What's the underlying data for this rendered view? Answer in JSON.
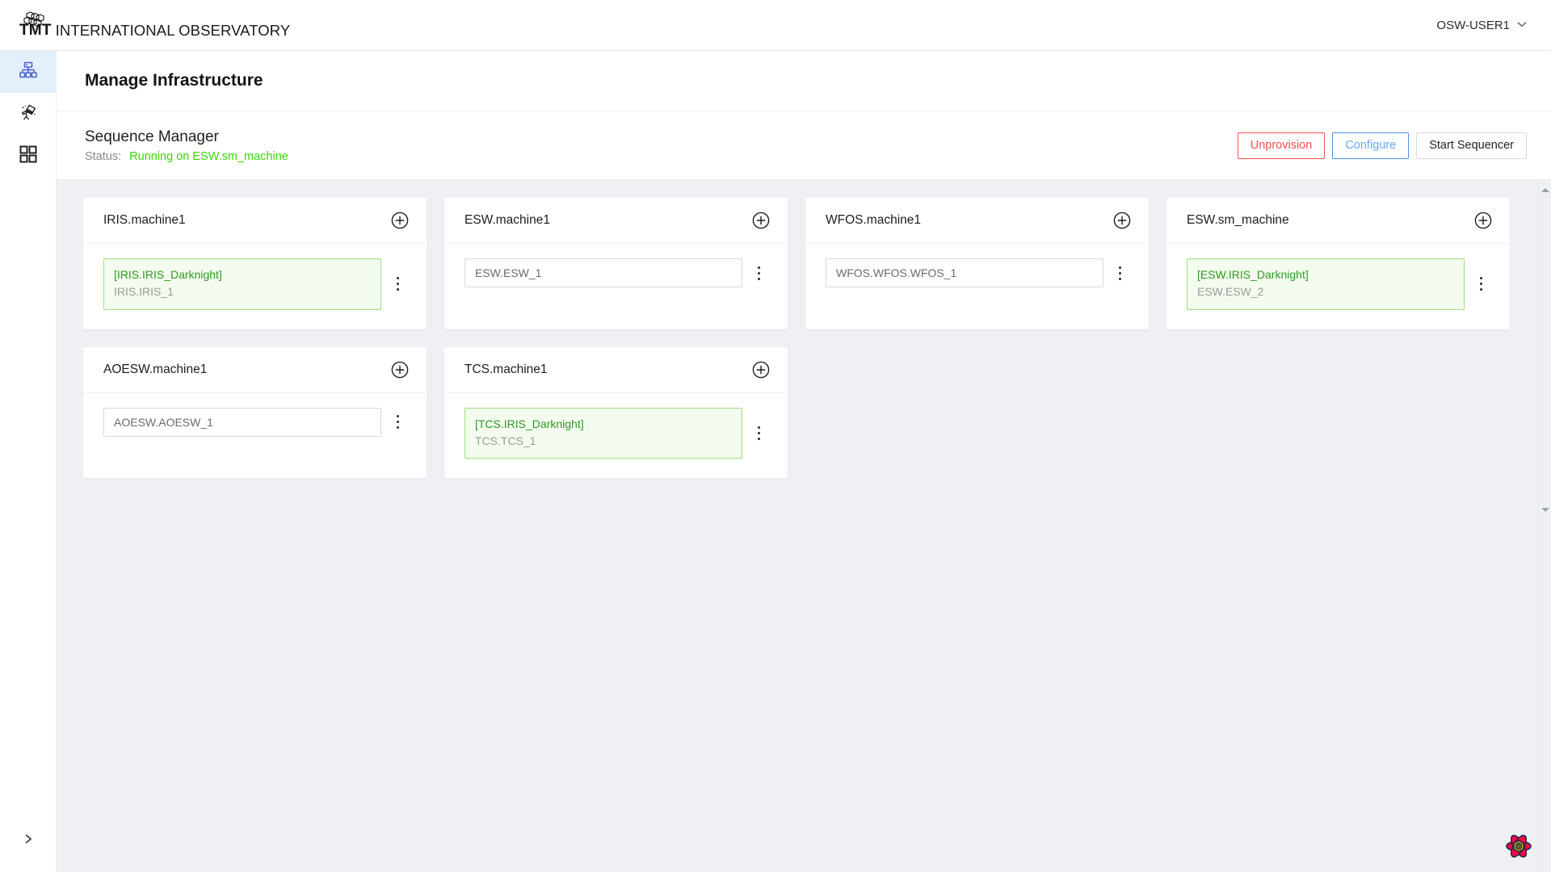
{
  "header": {
    "logo_tmt": "TMT",
    "logo_rest": "INTERNATIONAL OBSERVATORY",
    "logo_icon": "tmt-mirror-segments-logo",
    "user": "OSW-USER1",
    "user_caret_icon": "chevron-down-icon"
  },
  "rail": {
    "items": [
      {
        "icon": "infrastructure-hierarchy-icon",
        "active": true
      },
      {
        "icon": "telescope-icon",
        "active": false
      },
      {
        "icon": "apps-grid-icon",
        "active": false
      }
    ],
    "expand_icon": "chevron-right-icon"
  },
  "page": {
    "title": "Manage Infrastructure"
  },
  "sequence_manager": {
    "name": "Sequence Manager",
    "status_label": "Status:",
    "status_value": "Running on ESW.sm_machine",
    "status_color": "#36d900",
    "actions": [
      {
        "label": "Unprovision",
        "style": "danger"
      },
      {
        "label": "Configure",
        "style": "primary-ghost"
      },
      {
        "label": "Start Sequencer",
        "style": "default"
      }
    ]
  },
  "agents": [
    {
      "title": "IRIS.machine1",
      "add_icon": "plus-circle-icon",
      "sequencers": [
        {
          "running": true,
          "obs_mode": "[IRIS.IRIS_Darknight]",
          "id": "IRIS.IRIS_1",
          "menu_icon": "more-vertical-icon"
        }
      ]
    },
    {
      "title": "ESW.machine1",
      "add_icon": "plus-circle-icon",
      "sequencers": [
        {
          "running": false,
          "obs_mode": "",
          "id": "ESW.ESW_1",
          "menu_icon": "more-vertical-icon"
        }
      ]
    },
    {
      "title": "WFOS.machine1",
      "add_icon": "plus-circle-icon",
      "sequencers": [
        {
          "running": false,
          "obs_mode": "",
          "id": "WFOS.WFOS.WFOS_1",
          "menu_icon": "more-vertical-icon"
        }
      ]
    },
    {
      "title": "ESW.sm_machine",
      "add_icon": "plus-circle-icon",
      "sequencers": [
        {
          "running": true,
          "obs_mode": "[ESW.IRIS_Darknight]",
          "id": "ESW.ESW_2",
          "menu_icon": "more-vertical-icon"
        }
      ]
    },
    {
      "title": "AOESW.machine1",
      "add_icon": "plus-circle-icon",
      "sequencers": [
        {
          "running": false,
          "obs_mode": "",
          "id": "AOESW.AOESW_1",
          "menu_icon": "more-vertical-icon"
        }
      ]
    },
    {
      "title": "TCS.machine1",
      "add_icon": "plus-circle-icon",
      "sequencers": [
        {
          "running": true,
          "obs_mode": "[TCS.IRIS_Darknight]",
          "id": "TCS.TCS_1",
          "menu_icon": "more-vertical-icon"
        }
      ]
    }
  ],
  "scrollbar": {
    "up_icon": "scroll-up-arrow-icon",
    "down_icon": "scroll-down-arrow-icon"
  },
  "devtools": {
    "icon": "react-query-devtools-icon"
  },
  "colors": {
    "accent_blue": "#4d8fe8",
    "danger_red": "#ff4d4f",
    "running_green": "#2e9b1f",
    "status_green": "#36d900",
    "rail_active_bg": "#e3f0fb",
    "page_bg": "#eef0f4"
  }
}
